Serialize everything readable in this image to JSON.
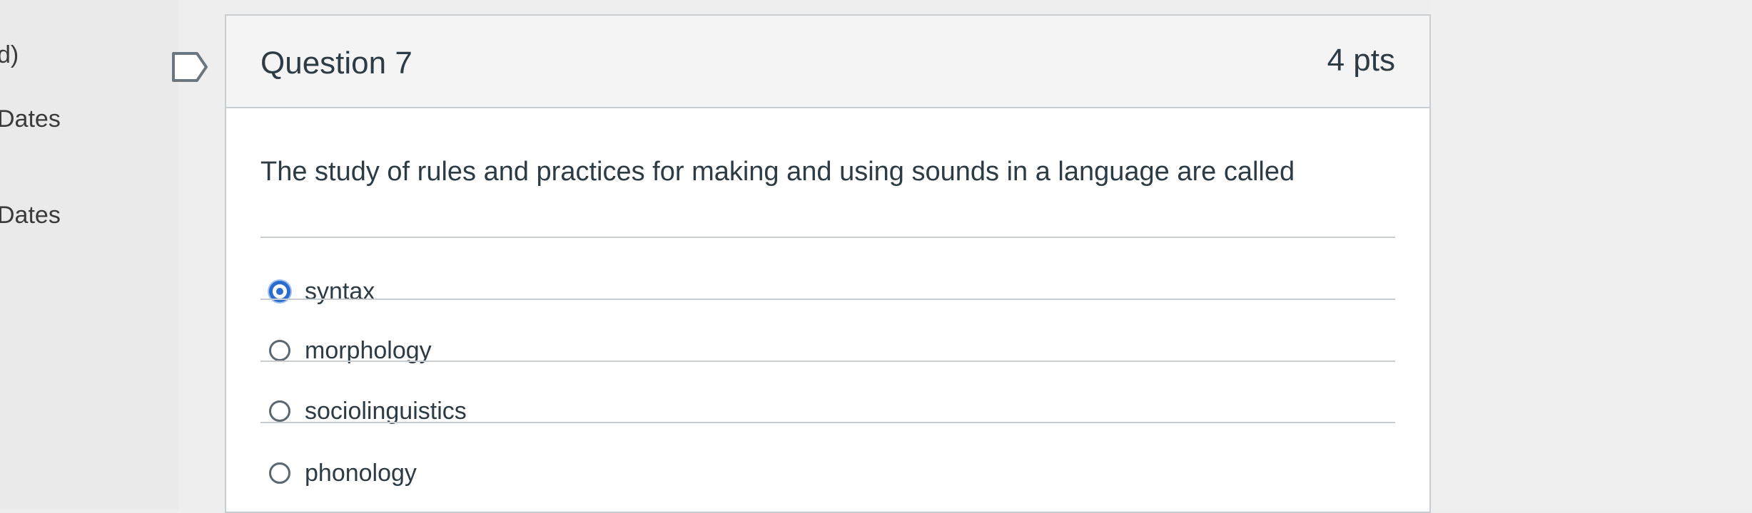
{
  "sidebar": {
    "fragments": [
      "d)",
      "Dates",
      "Dates"
    ]
  },
  "question": {
    "title": "Question 7",
    "points": "4 pts",
    "text": "The study of rules and practices for making and using sounds in a language are called",
    "answers": [
      {
        "label": "syntax",
        "selected": true
      },
      {
        "label": "morphology",
        "selected": false
      },
      {
        "label": "sociolinguistics",
        "selected": false
      },
      {
        "label": "phonology",
        "selected": false
      }
    ]
  },
  "colors": {
    "accent": "#2b6cd0",
    "text": "#2d3b45",
    "border": "#c7cdd1"
  }
}
